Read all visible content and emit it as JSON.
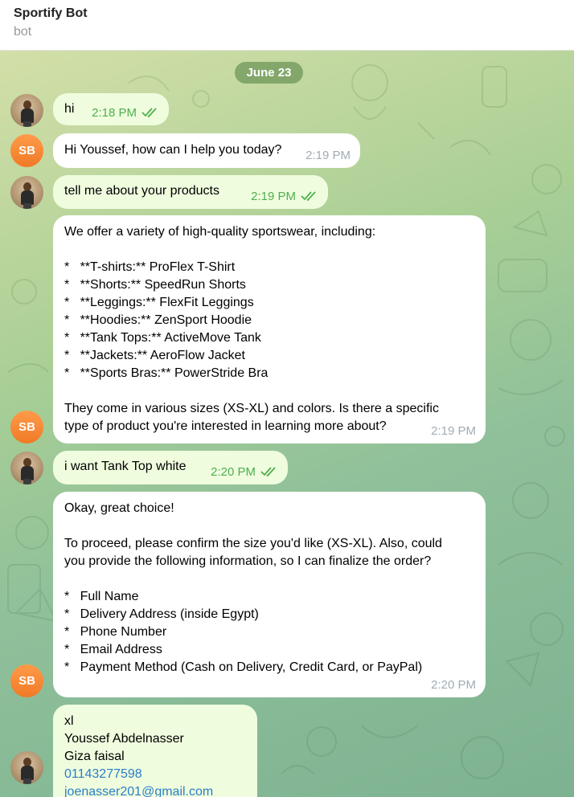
{
  "header": {
    "title": "Sportify Bot",
    "subtitle": "bot"
  },
  "date_label": "June 23",
  "bot_avatar_initials": "SB",
  "messages": [
    {
      "text": "hi",
      "time": "2:18 PM"
    },
    {
      "text": "Hi Youssef, how can I help you today?",
      "time": "2:19 PM"
    },
    {
      "text": "tell me about your products",
      "time": "2:19 PM"
    },
    {
      "text": "We offer a variety of high-quality sportswear, including:\n\n*   **T-shirts:** ProFlex T-Shirt\n*   **Shorts:** SpeedRun Shorts\n*   **Leggings:** FlexFit Leggings\n*   **Hoodies:** ZenSport Hoodie\n*   **Tank Tops:** ActiveMove Tank\n*   **Jackets:** AeroFlow Jacket\n*   **Sports Bras:** PowerStride Bra\n\nThey come in various sizes (XS-XL) and colors. Is there a specific\ntype of product you're interested in learning more about?",
      "time": "2:19 PM"
    },
    {
      "text": "i want Tank Top white",
      "time": "2:20 PM"
    },
    {
      "text": "Okay, great choice!\n\nTo proceed, please confirm the size you'd like (XS-XL). Also, could\nyou provide the following information, so I can finalize the order?\n\n*   Full Name\n*   Delivery Address (inside Egypt)\n*   Phone Number\n*   Email Address\n*   Payment Method (Cash on Delivery, Credit Card, or PayPal)",
      "time": "2:20 PM"
    },
    {
      "lines": [
        "xl",
        "Youssef Abdelnasser",
        "Giza faisal"
      ],
      "phone": "01143277598",
      "email": "joenasser201@gmail.com"
    }
  ]
}
